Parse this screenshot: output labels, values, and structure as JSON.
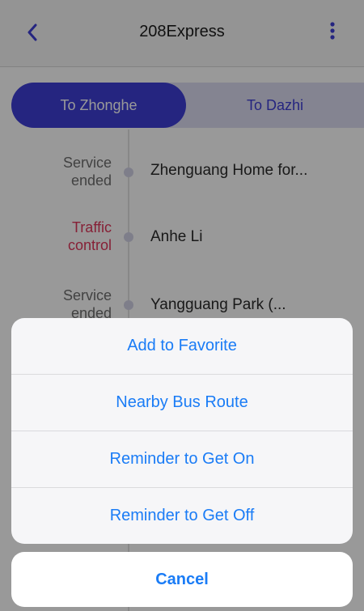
{
  "nav": {
    "title": "208Express",
    "back_icon": "chevron-left-icon",
    "more_icon": "more-vertical-icon",
    "accent_color": "#3f3fd6"
  },
  "direction_tabs": [
    {
      "label": "To Zhonghe",
      "active": true
    },
    {
      "label": "To Dazhi",
      "active": false
    }
  ],
  "stops": [
    {
      "status": "Service ended",
      "status_lines": [
        "Service",
        "ended"
      ],
      "status_type": "ended",
      "name": "Zhenguang Home for..."
    },
    {
      "status": "Traffic control",
      "status_lines": [
        "Traffic",
        "control"
      ],
      "status_type": "traffic",
      "name": "Anhe Li"
    },
    {
      "status": "Service ended",
      "status_lines": [
        "Service",
        "ended"
      ],
      "status_type": "ended",
      "name": "Yangguang Park (..."
    }
  ],
  "action_sheet": {
    "items": [
      {
        "label": "Add to Favorite"
      },
      {
        "label": "Nearby Bus Route"
      },
      {
        "label": "Reminder to Get On"
      },
      {
        "label": "Reminder to Get Off"
      }
    ],
    "cancel_label": "Cancel",
    "action_color": "#1a7cf6"
  },
  "status_colors": {
    "ended": "#6e6e6e",
    "traffic": "#e0365a"
  }
}
